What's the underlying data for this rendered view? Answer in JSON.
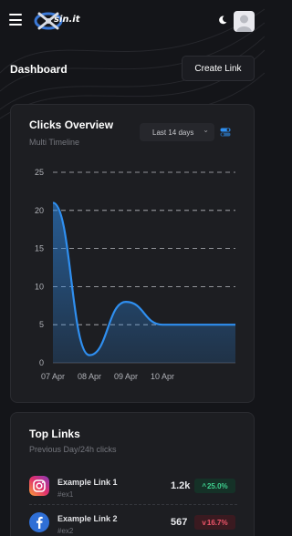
{
  "header": {
    "logo_text": "sin.it",
    "icons": {
      "menu": "menu-icon",
      "theme": "moon-icon",
      "avatar": "user-avatar-icon"
    }
  },
  "page": {
    "title": "Dashboard",
    "create_label": "Create Link"
  },
  "clicks_card": {
    "title": "Clicks Overview",
    "subtitle": "Multi Timeline",
    "range_value": "Last 14 days",
    "range_icon": "chevron-down-icon",
    "toggle_icon": "toggle-icon"
  },
  "chart_data": {
    "type": "area",
    "title": "Clicks Overview",
    "subtitle": "Multi Timeline",
    "x_ticks": [
      "07 Apr",
      "08 Apr",
      "09 Apr",
      "10 Apr"
    ],
    "y_ticks": [
      0,
      5,
      10,
      15,
      20,
      25
    ],
    "ylim": [
      0,
      25
    ],
    "xlim": [
      0,
      5
    ],
    "grid": true,
    "color": "#2f8ff0",
    "series": [
      {
        "x": [
          0,
          1,
          2,
          3,
          4,
          5
        ],
        "values": [
          21,
          1,
          8,
          5,
          5,
          5
        ]
      }
    ]
  },
  "links_card": {
    "title": "Top Links",
    "subtitle": "Previous Day/24h clicks",
    "rows": [
      {
        "name": "Example Link 1",
        "tag": "#ex1",
        "count": "1.2k",
        "change": "25.0%",
        "direction": "up",
        "arrow": "^",
        "icon": "instagram-icon",
        "color": "#d6336c"
      },
      {
        "name": "Example Link 2",
        "tag": "#ex2",
        "count": "567",
        "change": "16.7%",
        "direction": "down",
        "arrow": "v",
        "icon": "facebook-icon",
        "color": "#1f5fbf"
      }
    ]
  }
}
